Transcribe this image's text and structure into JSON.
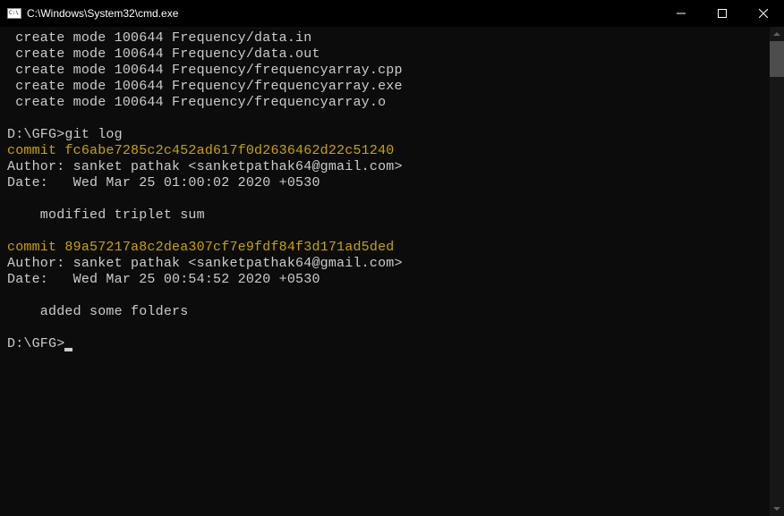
{
  "titlebar": {
    "title": "C:\\Windows\\System32\\cmd.exe"
  },
  "term": {
    "create1": " create mode 100644 Frequency/data.in",
    "create2": " create mode 100644 Frequency/data.out",
    "create3": " create mode 100644 Frequency/frequencyarray.cpp",
    "create4": " create mode 100644 Frequency/frequencyarray.exe",
    "create5": " create mode 100644 Frequency/frequencyarray.o",
    "blank": "",
    "prompt1": "D:\\GFG>git log",
    "commit1_line": "commit fc6abe7285c2c452ad617f0d2636462d22c51240",
    "commit1_author": "Author: sanket pathak <sanketpathak64@gmail.com>",
    "commit1_date": "Date:   Wed Mar 25 01:00:02 2020 +0530",
    "commit1_msg": "    modified triplet sum",
    "commit2_line": "commit 89a57217a8c2dea307cf7e9fdf84f3d171ad5ded",
    "commit2_author": "Author: sanket pathak <sanketpathak64@gmail.com>",
    "commit2_date": "Date:   Wed Mar 25 00:54:52 2020 +0530",
    "commit2_msg": "    added some folders",
    "prompt2": "D:\\GFG>"
  }
}
